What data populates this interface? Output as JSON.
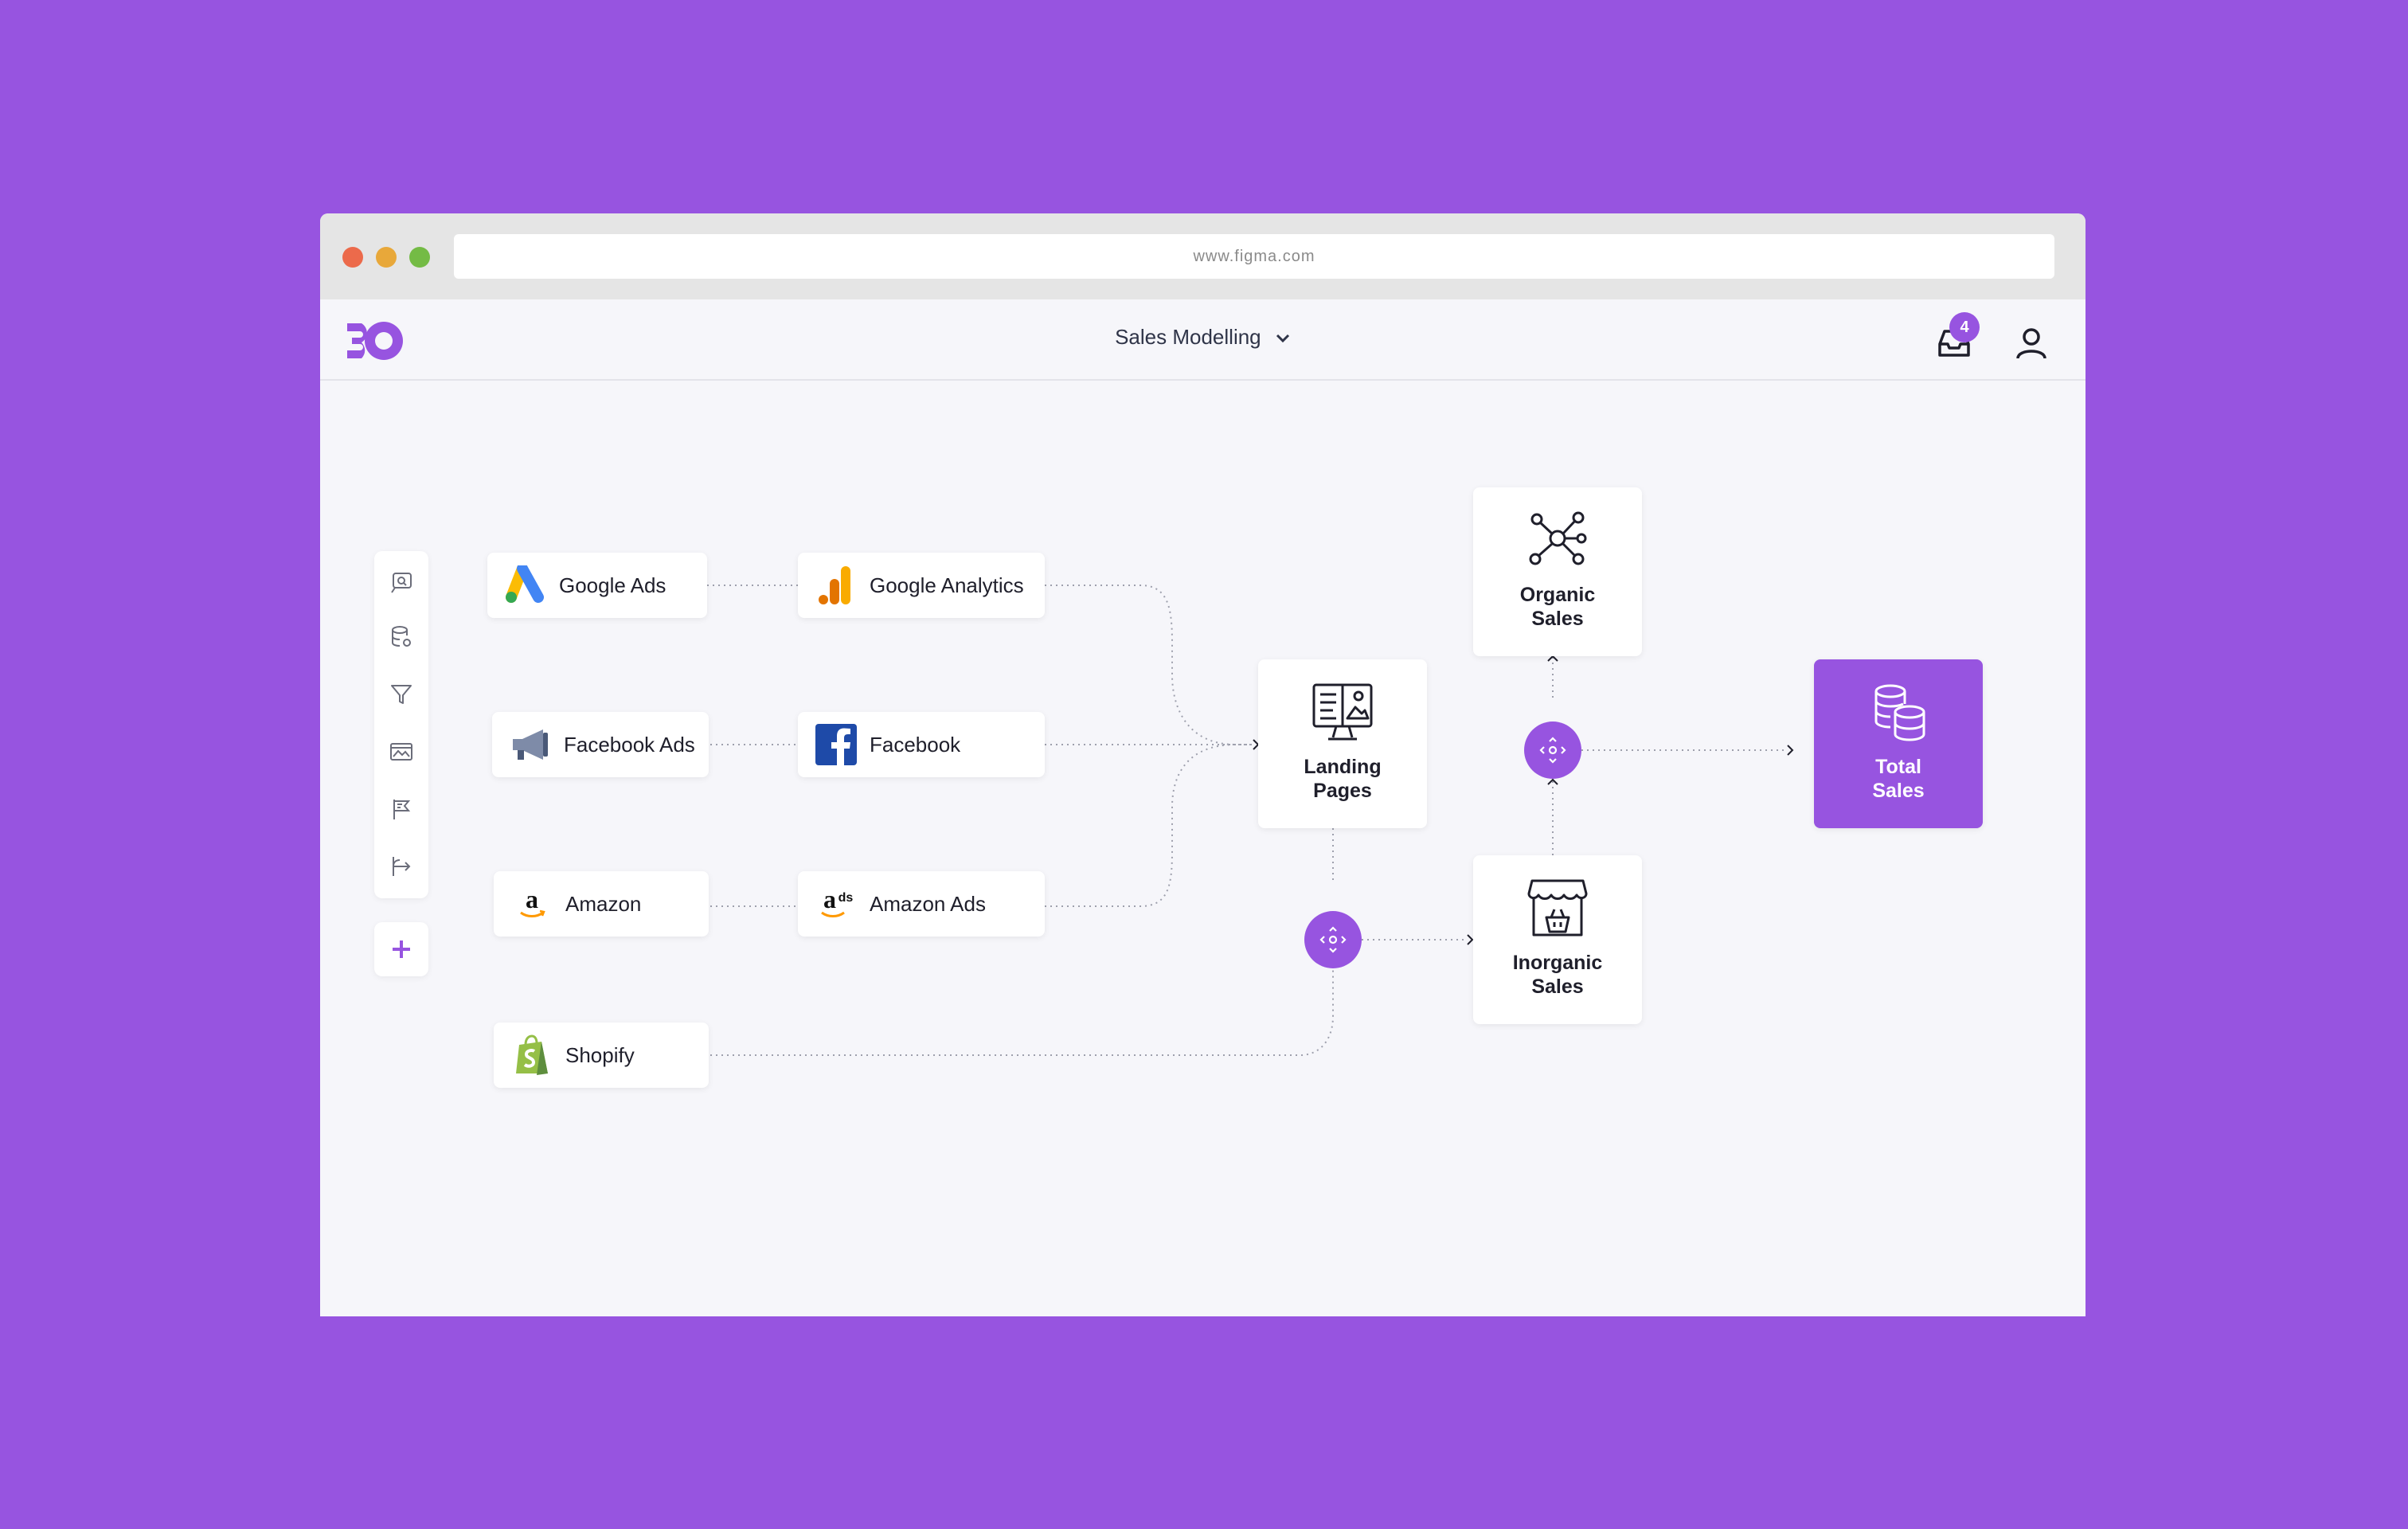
{
  "browser": {
    "url": "www.figma.com"
  },
  "app": {
    "title": "Sales Modelling",
    "notifications_count": "4"
  },
  "toolbar": {
    "tools": [
      "chat-search-icon",
      "database-settings-icon",
      "filter-icon",
      "image-window-icon",
      "flag-icon",
      "branch-arrow-icon"
    ],
    "add": "plus-icon"
  },
  "sources": {
    "google_ads": "Google Ads",
    "google_analytics": "Google Analytics",
    "facebook_ads": "Facebook Ads",
    "facebook": "Facebook",
    "amazon": "Amazon",
    "amazon_ads": "Amazon Ads",
    "shopify": "Shopify"
  },
  "nodes": {
    "landing_line1": "Landing",
    "landing_line2": "Pages",
    "organic_line1": "Organic",
    "organic_line2": "Sales",
    "inorganic_line1": "Inorganic",
    "inorganic_line2": "Sales",
    "total_line1": "Total",
    "total_line2": "Sales"
  },
  "colors": {
    "background": "#9754e0",
    "accent": "#9754e0",
    "canvas": "#f6f6fa"
  }
}
